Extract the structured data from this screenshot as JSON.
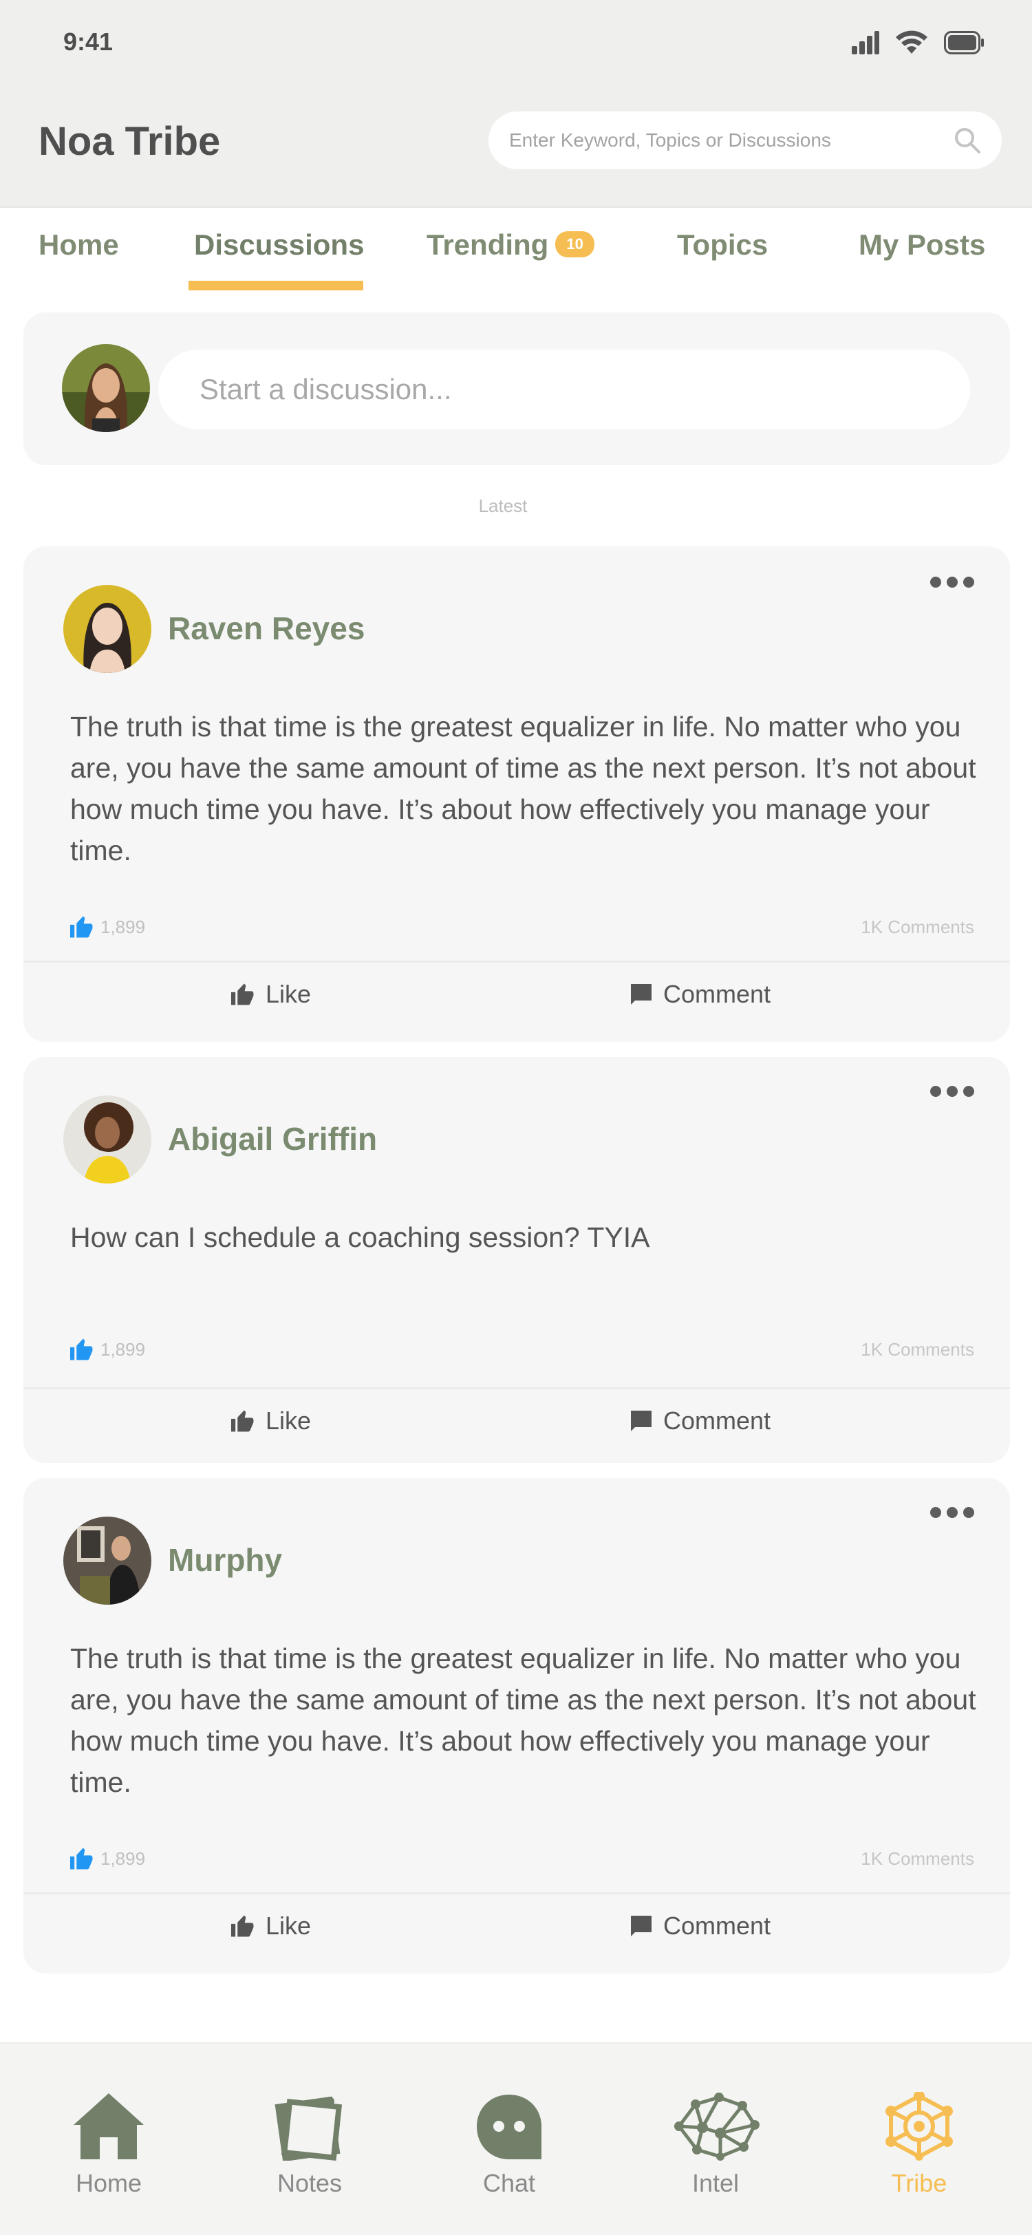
{
  "status_bar": {
    "time": "9:41"
  },
  "header": {
    "title": "Noa Tribe",
    "search_placeholder": "Enter Keyword, Topics or Discussions"
  },
  "tabs": [
    {
      "label": "Home"
    },
    {
      "label": "Discussions",
      "active": true
    },
    {
      "label": "Trending",
      "badge": "10"
    },
    {
      "label": "Topics"
    },
    {
      "label": "My Posts"
    }
  ],
  "composer": {
    "placeholder": "Start a discussion..."
  },
  "feed": {
    "section_label": "Latest"
  },
  "posts": [
    {
      "author": "Raven Reyes",
      "body": "The truth is that time is the greatest equalizer in life. No matter who you are, you have the same amount of time as the next person. It’s not about how much time you have. It’s about how effectively you manage your time.",
      "likes": "1,899",
      "comments": "1K Comments",
      "like_label": "Like",
      "comment_label": "Comment"
    },
    {
      "author": "Abigail Griffin",
      "body": "How can I schedule a coaching session? TYIA",
      "likes": "1,899",
      "comments": "1K Comments",
      "like_label": "Like",
      "comment_label": "Comment"
    },
    {
      "author": "Murphy",
      "body": "The truth is that time is the greatest equalizer in life. No matter who you are, you have the same amount of time as the next person. It’s not about how much time you have. It’s about how effectively you manage your time.",
      "likes": "1,899",
      "comments": "1K Comments",
      "like_label": "Like",
      "comment_label": "Comment"
    }
  ],
  "bottom_nav": [
    {
      "label": "Home",
      "icon": "home-icon"
    },
    {
      "label": "Notes",
      "icon": "notes-icon"
    },
    {
      "label": "Chat",
      "icon": "chat-icon"
    },
    {
      "label": "Intel",
      "icon": "brain-network-icon"
    },
    {
      "label": "Tribe",
      "icon": "tribe-icon",
      "active": true
    }
  ],
  "colors": {
    "accent": "#f6be52",
    "brand_green": "#7b8b70",
    "like_blue": "#2196f3",
    "header_bg": "#eff0ed",
    "card_bg": "#f6f6f6"
  }
}
